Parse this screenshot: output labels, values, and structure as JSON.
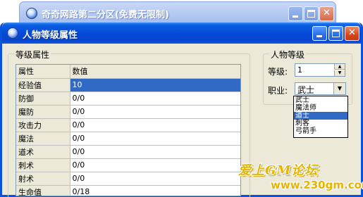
{
  "background_window": {
    "title": "奇奇网路第二分区(免费无限制)"
  },
  "dialog": {
    "title": "人物等级属性",
    "controls": {
      "minimize": "minimize-icon",
      "maximize": "maximize-icon",
      "close": "close-icon"
    }
  },
  "attributes": {
    "group_label": "等级属性",
    "header": {
      "key": "属性",
      "value": "数值"
    },
    "rows": [
      {
        "key": "经验值",
        "value": "10",
        "selected": true
      },
      {
        "key": "防御",
        "value": "0/0"
      },
      {
        "key": "魔防",
        "value": "0/0"
      },
      {
        "key": "攻击力",
        "value": "0/0"
      },
      {
        "key": "魔法",
        "value": "0/0"
      },
      {
        "key": "道术",
        "value": "0/0"
      },
      {
        "key": "刺术",
        "value": "0/0"
      },
      {
        "key": "射术",
        "value": "0/0"
      },
      {
        "key": "生命值",
        "value": "0/18"
      }
    ]
  },
  "level_panel": {
    "group_label": "人物等级",
    "level_label": "等级:",
    "level_value": "1",
    "class_label": "职业:",
    "class_value": "武士",
    "class_options": [
      "武士",
      "魔法师",
      "道士",
      "刺客",
      "弓箭手"
    ],
    "class_highlighted": "道士"
  },
  "watermark": {
    "line1": "爱上GM论坛",
    "line2": "www.230gm.com"
  },
  "colors": {
    "titlebar": "#0548d6",
    "selection": "#316ac5",
    "dialog_bg": "#ece9d8",
    "watermark": "#e8b400"
  }
}
